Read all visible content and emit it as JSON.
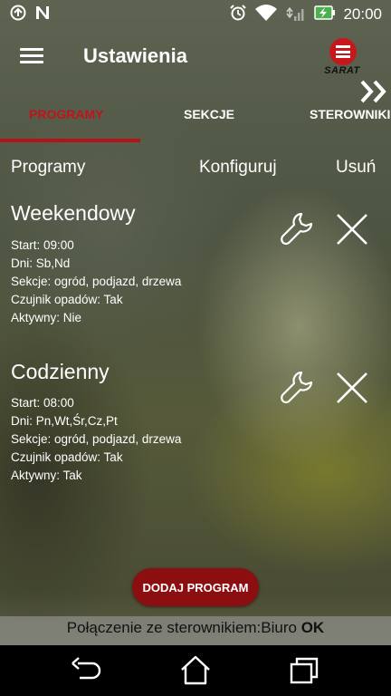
{
  "status_bar": {
    "time": "20:00",
    "icons": [
      "sync-icon",
      "notification-n-icon",
      "alarm-icon",
      "wifi-icon",
      "signal-icon",
      "battery-charging-icon"
    ]
  },
  "toolbar": {
    "menu_icon": "hamburger-menu-icon",
    "title": "Ustawienia",
    "logo_text": "SARAT"
  },
  "tabs": [
    {
      "label": "PROGRAMY",
      "active": true
    },
    {
      "label": "SEKCJE",
      "active": false
    },
    {
      "label": "STEROWNIKI",
      "active": false
    }
  ],
  "accent_color": "#c0141a",
  "header": {
    "col_programs": "Programy",
    "col_configure": "Konfiguruj",
    "col_delete": "Usuń"
  },
  "programs": [
    {
      "name": "Weekendowy",
      "start": "Start: 09:00",
      "days": "Dni: Sb,Nd",
      "sections": "Sekcje: ogród, podjazd, drzewa",
      "rain_sensor": "Czujnik opadów: Tak",
      "active": "Aktywny: Nie"
    },
    {
      "name": "Codzienny",
      "start": "Start: 08:00",
      "days": "Dni: Pn,Wt,Śr,Cz,Pt",
      "sections": "Sekcje: ogród, podjazd, drzewa",
      "rain_sensor": "Czujnik opadów: Tak",
      "active": "Aktywny: Tak"
    }
  ],
  "add_button": "DODAJ PROGRAM",
  "connection": {
    "label": "Połączenie ze sterownikiem:Biuro",
    "status": "OK"
  },
  "nav": {
    "back": "back-icon",
    "home": "home-icon",
    "recents": "recent-apps-icon"
  }
}
